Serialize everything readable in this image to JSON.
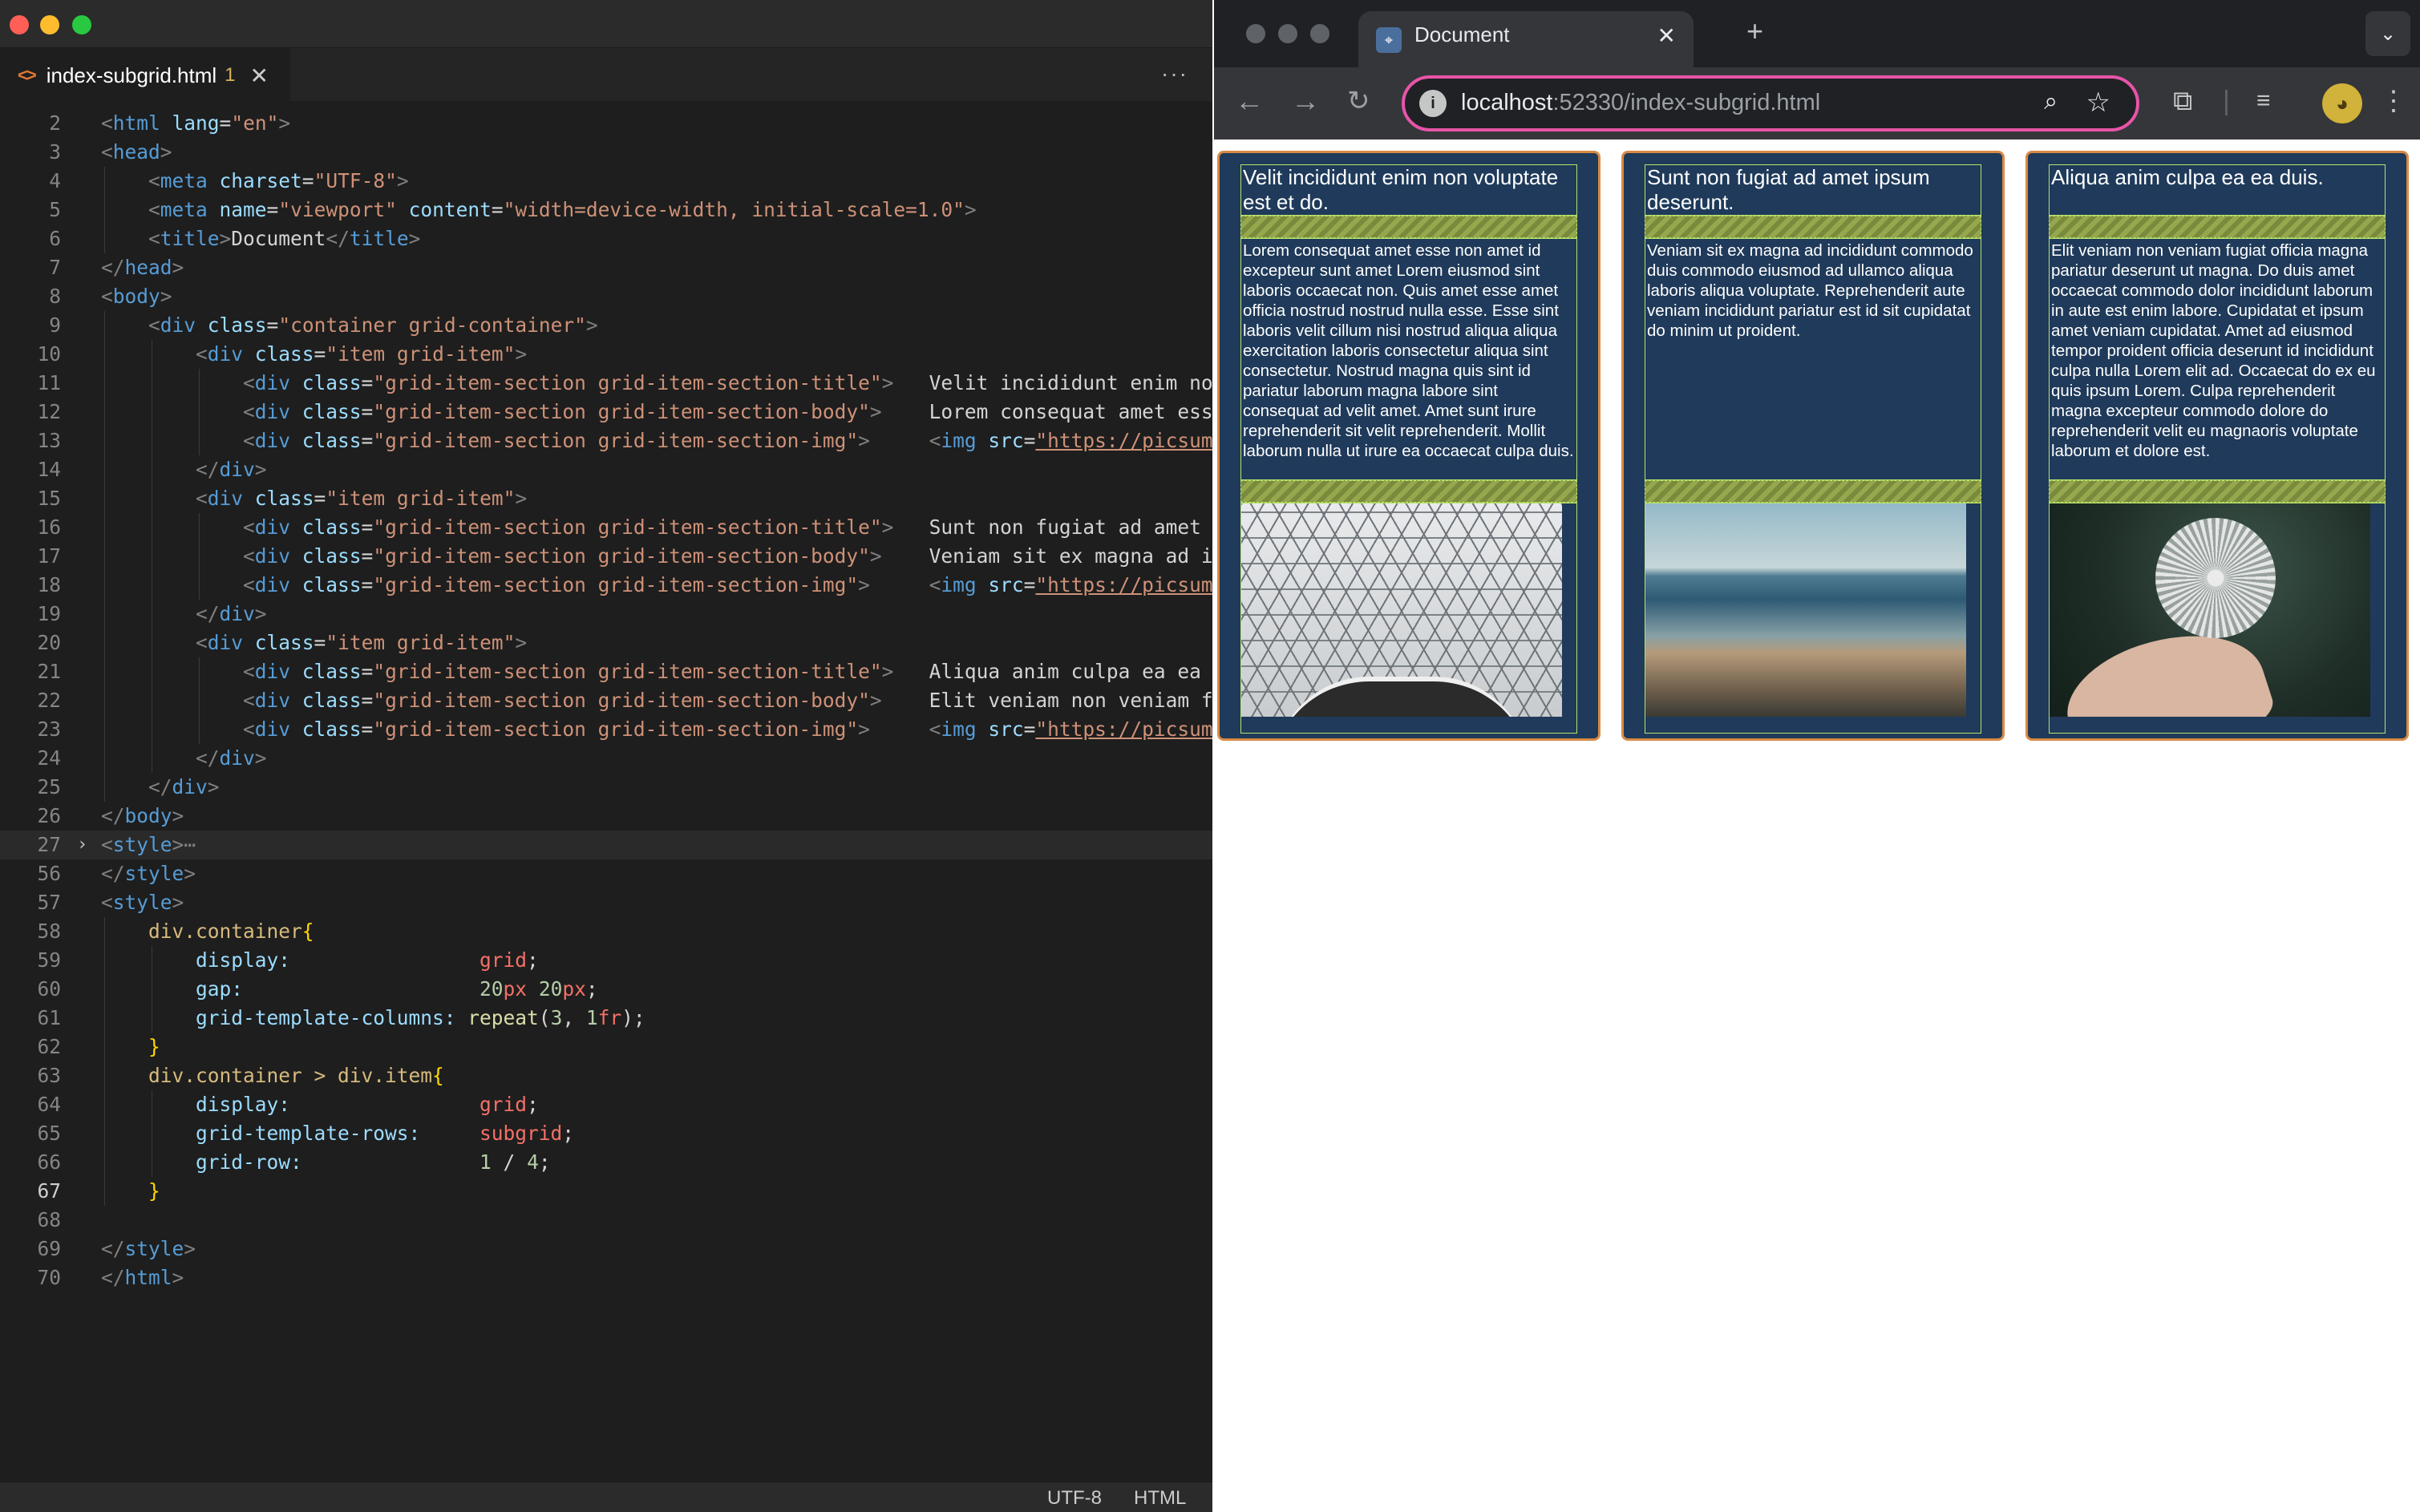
{
  "editor": {
    "tab": {
      "filename": "index-subgrid.html",
      "problems": "1"
    },
    "status": {
      "encoding": "UTF-8",
      "language": "HTML"
    },
    "lines": [
      {
        "n": "2",
        "indent": 0,
        "parts": [
          [
            "tg",
            "<"
          ],
          [
            "tn2",
            "html "
          ],
          [
            "at",
            "lang"
          ],
          [
            "pun",
            "="
          ],
          [
            "av",
            "\"en\""
          ],
          [
            "tg",
            ">"
          ]
        ]
      },
      {
        "n": "3",
        "indent": 0,
        "parts": [
          [
            "tg",
            "<"
          ],
          [
            "tn2",
            "head"
          ],
          [
            "tg",
            ">"
          ]
        ]
      },
      {
        "n": "4",
        "indent": 1,
        "parts": [
          [
            "tg",
            "<"
          ],
          [
            "tn2",
            "meta "
          ],
          [
            "at",
            "charset"
          ],
          [
            "pun",
            "="
          ],
          [
            "av",
            "\"UTF-8\""
          ],
          [
            "tg",
            ">"
          ]
        ]
      },
      {
        "n": "5",
        "indent": 1,
        "parts": [
          [
            "tg",
            "<"
          ],
          [
            "tn2",
            "meta "
          ],
          [
            "at",
            "name"
          ],
          [
            "pun",
            "="
          ],
          [
            "av",
            "\"viewport\" "
          ],
          [
            "at",
            "content"
          ],
          [
            "pun",
            "="
          ],
          [
            "av",
            "\"width=device-width, initial-scale=1.0\""
          ],
          [
            "tg",
            ">"
          ]
        ]
      },
      {
        "n": "6",
        "indent": 1,
        "parts": [
          [
            "tg",
            "<"
          ],
          [
            "tn2",
            "title"
          ],
          [
            "tg",
            ">"
          ],
          [
            "tx2",
            "Document"
          ],
          [
            "tg",
            "</"
          ],
          [
            "tn2",
            "title"
          ],
          [
            "tg",
            ">"
          ]
        ]
      },
      {
        "n": "7",
        "indent": 0,
        "parts": [
          [
            "tg",
            "</"
          ],
          [
            "tn2",
            "head"
          ],
          [
            "tg",
            ">"
          ]
        ]
      },
      {
        "n": "8",
        "indent": 0,
        "parts": [
          [
            "tg",
            "<"
          ],
          [
            "tn2",
            "body"
          ],
          [
            "tg",
            ">"
          ]
        ]
      },
      {
        "n": "9",
        "indent": 1,
        "parts": [
          [
            "tg",
            "<"
          ],
          [
            "tn2",
            "div "
          ],
          [
            "at",
            "class"
          ],
          [
            "pun",
            "="
          ],
          [
            "av",
            "\"container grid-container\""
          ],
          [
            "tg",
            ">"
          ]
        ]
      },
      {
        "n": "10",
        "indent": 2,
        "parts": [
          [
            "tg",
            "<"
          ],
          [
            "tn2",
            "div "
          ],
          [
            "at",
            "class"
          ],
          [
            "pun",
            "="
          ],
          [
            "av",
            "\"item grid-item\""
          ],
          [
            "tg",
            ">"
          ]
        ]
      },
      {
        "n": "11",
        "indent": 3,
        "parts": [
          [
            "tg",
            "<"
          ],
          [
            "tn2",
            "div "
          ],
          [
            "at",
            "class"
          ],
          [
            "pun",
            "="
          ],
          [
            "av",
            "\"grid-item-section grid-item-section-title\""
          ],
          [
            "tg",
            ">"
          ],
          [
            "tx2",
            "   Velit incididunt enim no"
          ]
        ]
      },
      {
        "n": "12",
        "indent": 3,
        "parts": [
          [
            "tg",
            "<"
          ],
          [
            "tn2",
            "div "
          ],
          [
            "at",
            "class"
          ],
          [
            "pun",
            "="
          ],
          [
            "av",
            "\"grid-item-section grid-item-section-body\""
          ],
          [
            "tg",
            ">"
          ],
          [
            "tx2",
            "    Lorem consequat amet ess"
          ]
        ]
      },
      {
        "n": "13",
        "indent": 3,
        "parts": [
          [
            "tg",
            "<"
          ],
          [
            "tn2",
            "div "
          ],
          [
            "at",
            "class"
          ],
          [
            "pun",
            "="
          ],
          [
            "av",
            "\"grid-item-section grid-item-section-img\""
          ],
          [
            "tg",
            ">"
          ],
          [
            "tx2",
            "     "
          ],
          [
            "tg",
            "<"
          ],
          [
            "tn2",
            "img "
          ],
          [
            "at",
            "src"
          ],
          [
            "pun",
            "="
          ],
          [
            "url",
            "\"https://picsum"
          ]
        ]
      },
      {
        "n": "14",
        "indent": 2,
        "parts": [
          [
            "tg",
            "</"
          ],
          [
            "tn2",
            "div"
          ],
          [
            "tg",
            ">"
          ]
        ]
      },
      {
        "n": "15",
        "indent": 2,
        "parts": [
          [
            "tg",
            "<"
          ],
          [
            "tn2",
            "div "
          ],
          [
            "at",
            "class"
          ],
          [
            "pun",
            "="
          ],
          [
            "av",
            "\"item grid-item\""
          ],
          [
            "tg",
            ">"
          ]
        ]
      },
      {
        "n": "16",
        "indent": 3,
        "parts": [
          [
            "tg",
            "<"
          ],
          [
            "tn2",
            "div "
          ],
          [
            "at",
            "class"
          ],
          [
            "pun",
            "="
          ],
          [
            "av",
            "\"grid-item-section grid-item-section-title\""
          ],
          [
            "tg",
            ">"
          ],
          [
            "tx2",
            "   Sunt non fugiat ad amet "
          ]
        ]
      },
      {
        "n": "17",
        "indent": 3,
        "parts": [
          [
            "tg",
            "<"
          ],
          [
            "tn2",
            "div "
          ],
          [
            "at",
            "class"
          ],
          [
            "pun",
            "="
          ],
          [
            "av",
            "\"grid-item-section grid-item-section-body\""
          ],
          [
            "tg",
            ">"
          ],
          [
            "tx2",
            "    Veniam sit ex magna ad i"
          ]
        ]
      },
      {
        "n": "18",
        "indent": 3,
        "parts": [
          [
            "tg",
            "<"
          ],
          [
            "tn2",
            "div "
          ],
          [
            "at",
            "class"
          ],
          [
            "pun",
            "="
          ],
          [
            "av",
            "\"grid-item-section grid-item-section-img\""
          ],
          [
            "tg",
            ">"
          ],
          [
            "tx2",
            "     "
          ],
          [
            "tg",
            "<"
          ],
          [
            "tn2",
            "img "
          ],
          [
            "at",
            "src"
          ],
          [
            "pun",
            "="
          ],
          [
            "url",
            "\"https://picsum"
          ]
        ]
      },
      {
        "n": "19",
        "indent": 2,
        "parts": [
          [
            "tg",
            "</"
          ],
          [
            "tn2",
            "div"
          ],
          [
            "tg",
            ">"
          ]
        ]
      },
      {
        "n": "20",
        "indent": 2,
        "parts": [
          [
            "tg",
            "<"
          ],
          [
            "tn2",
            "div "
          ],
          [
            "at",
            "class"
          ],
          [
            "pun",
            "="
          ],
          [
            "av",
            "\"item grid-item\""
          ],
          [
            "tg",
            ">"
          ]
        ]
      },
      {
        "n": "21",
        "indent": 3,
        "parts": [
          [
            "tg",
            "<"
          ],
          [
            "tn2",
            "div "
          ],
          [
            "at",
            "class"
          ],
          [
            "pun",
            "="
          ],
          [
            "av",
            "\"grid-item-section grid-item-section-title\""
          ],
          [
            "tg",
            ">"
          ],
          [
            "tx2",
            "   Aliqua anim culpa ea ea "
          ]
        ]
      },
      {
        "n": "22",
        "indent": 3,
        "parts": [
          [
            "tg",
            "<"
          ],
          [
            "tn2",
            "div "
          ],
          [
            "at",
            "class"
          ],
          [
            "pun",
            "="
          ],
          [
            "av",
            "\"grid-item-section grid-item-section-body\""
          ],
          [
            "tg",
            ">"
          ],
          [
            "tx2",
            "    Elit veniam non veniam f"
          ]
        ]
      },
      {
        "n": "23",
        "indent": 3,
        "parts": [
          [
            "tg",
            "<"
          ],
          [
            "tn2",
            "div "
          ],
          [
            "at",
            "class"
          ],
          [
            "pun",
            "="
          ],
          [
            "av",
            "\"grid-item-section grid-item-section-img\""
          ],
          [
            "tg",
            ">"
          ],
          [
            "tx2",
            "     "
          ],
          [
            "tg",
            "<"
          ],
          [
            "tn2",
            "img "
          ],
          [
            "at",
            "src"
          ],
          [
            "pun",
            "="
          ],
          [
            "url",
            "\"https://picsum"
          ]
        ]
      },
      {
        "n": "24",
        "indent": 2,
        "parts": [
          [
            "tg",
            "</"
          ],
          [
            "tn2",
            "div"
          ],
          [
            "tg",
            ">"
          ]
        ]
      },
      {
        "n": "25",
        "indent": 1,
        "parts": [
          [
            "tg",
            "</"
          ],
          [
            "tn2",
            "div"
          ],
          [
            "tg",
            ">"
          ]
        ]
      },
      {
        "n": "26",
        "indent": 0,
        "parts": [
          [
            "tg",
            "</"
          ],
          [
            "tn2",
            "body"
          ],
          [
            "tg",
            ">"
          ]
        ]
      },
      {
        "n": "27",
        "indent": 0,
        "fold": true,
        "highlight": true,
        "parts": [
          [
            "tg",
            "<"
          ],
          [
            "tn2",
            "style"
          ],
          [
            "tg",
            ">"
          ],
          [
            "tg",
            "⋯"
          ]
        ]
      },
      {
        "n": "56",
        "indent": 0,
        "parts": [
          [
            "tg",
            "</"
          ],
          [
            "tn2",
            "style"
          ],
          [
            "tg",
            ">"
          ]
        ]
      },
      {
        "n": "57",
        "indent": 0,
        "parts": [
          [
            "tg",
            "<"
          ],
          [
            "tn2",
            "style"
          ],
          [
            "tg",
            ">"
          ]
        ]
      },
      {
        "n": "58",
        "indent": 1,
        "parts": [
          [
            "sel",
            "div.container"
          ],
          [
            "brk",
            "{"
          ]
        ]
      },
      {
        "n": "59",
        "indent": 2,
        "parts": [
          [
            "pr",
            "display:"
          ],
          [
            "tx2",
            "                "
          ],
          [
            "kw",
            "grid"
          ],
          [
            "pun",
            ";"
          ]
        ]
      },
      {
        "n": "60",
        "indent": 2,
        "parts": [
          [
            "pr",
            "gap:"
          ],
          [
            "tx2",
            "                    "
          ],
          [
            "num",
            "20"
          ],
          [
            "kw",
            "px "
          ],
          [
            "num",
            "20"
          ],
          [
            "kw",
            "px"
          ],
          [
            "pun",
            ";"
          ]
        ]
      },
      {
        "n": "61",
        "indent": 2,
        "parts": [
          [
            "pr",
            "grid-template-columns:"
          ],
          [
            "tx2",
            " "
          ],
          [
            "fn",
            "repeat"
          ],
          [
            "pun",
            "("
          ],
          [
            "num",
            "3"
          ],
          [
            "pun",
            ", "
          ],
          [
            "num",
            "1"
          ],
          [
            "kw",
            "fr"
          ],
          [
            "pun",
            ");"
          ]
        ]
      },
      {
        "n": "62",
        "indent": 1,
        "parts": [
          [
            "brk",
            "}"
          ]
        ]
      },
      {
        "n": "63",
        "indent": 1,
        "parts": [
          [
            "sel",
            "div.container > div.item"
          ],
          [
            "brk",
            "{"
          ]
        ]
      },
      {
        "n": "64",
        "indent": 2,
        "parts": [
          [
            "pr",
            "display:"
          ],
          [
            "tx2",
            "                "
          ],
          [
            "kw",
            "grid"
          ],
          [
            "pun",
            ";"
          ]
        ]
      },
      {
        "n": "65",
        "indent": 2,
        "parts": [
          [
            "pr",
            "grid-template-rows:"
          ],
          [
            "tx2",
            "     "
          ],
          [
            "kw",
            "subgrid"
          ],
          [
            "pun",
            ";"
          ]
        ]
      },
      {
        "n": "66",
        "indent": 2,
        "parts": [
          [
            "pr",
            "grid-row:"
          ],
          [
            "tx2",
            "               "
          ],
          [
            "num",
            "1"
          ],
          [
            "pun",
            " / "
          ],
          [
            "num",
            "4"
          ],
          [
            "pun",
            ";"
          ]
        ]
      },
      {
        "n": "67",
        "indent": 1,
        "current": true,
        "parts": [
          [
            "brk",
            "}"
          ]
        ]
      },
      {
        "n": "68",
        "indent": 0,
        "parts": []
      },
      {
        "n": "69",
        "indent": 0,
        "parts": [
          [
            "tg",
            "</"
          ],
          [
            "tn2",
            "style"
          ],
          [
            "tg",
            ">"
          ]
        ]
      },
      {
        "n": "70",
        "indent": 0,
        "parts": [
          [
            "tg",
            "</"
          ],
          [
            "tn2",
            "html"
          ],
          [
            "tg",
            ">"
          ]
        ]
      }
    ]
  },
  "browser": {
    "tab_title": "Document",
    "url_host": "localhost",
    "url_rest": ":52330/index-subgrid.html",
    "icons": [
      "back-icon",
      "forward-icon",
      "reload-icon",
      "info-icon",
      "zoom-icon",
      "star-icon",
      "extensions-icon",
      "media-icon",
      "profile-icon",
      "kebab-menu-icon"
    ],
    "cards": [
      {
        "title": "Velit incididunt enim non voluptate est et do.",
        "body": "Lorem consequat amet esse non amet id excepteur sunt amet Lorem eiusmod sint laboris occaecat non. Quis amet esse amet officia nostrud nostrud nulla esse. Esse sint laboris velit cillum nisi nostrud aliqua aliqua exercitation laboris consectetur aliqua sint consectetur. Nostrud magna quis sint id pariatur laborum magna labore sint consequat ad velit amet. Amet sunt irure reprehenderit sit velit reprehenderit. Mollit laborum nulla ut irure ea occaecat culpa duis.",
        "image": "glass-roof-photo"
      },
      {
        "title": "Sunt non fugiat ad amet ipsum deserunt.",
        "body": "Veniam sit ex magna ad incididunt commodo duis commodo eiusmod ad ullamco aliqua laboris aliqua voluptate. Reprehenderit aute veniam incididunt pariatur est id sit cupidatat do minim ut proident.",
        "image": "beach-photo"
      },
      {
        "title": "Aliqua anim culpa ea ea duis.",
        "body": "Elit veniam non veniam fugiat officia magna pariatur deserunt ut magna. Do duis amet occaecat commodo dolor incididunt laborum in aute est enim labore. Cupidatat et ipsum amet veniam cupidatat. Amet ad eiusmod tempor proident officia deserunt id incididunt culpa nulla Lorem elit ad. Occaecat do ex eu quis ipsum Lorem. Culpa reprehenderit magna excepteur commodo dolore do reprehenderit velit eu magnaoris voluptate laborum et dolore est.",
        "image": "dandelion-photo"
      }
    ]
  },
  "colors": {
    "editor_bg": "#1e1e1e",
    "card_bg": "#1f3a5a",
    "card_border": "#d98a44",
    "section_outline": "#b9e36b",
    "omnibox_focus": "#e754a8"
  }
}
